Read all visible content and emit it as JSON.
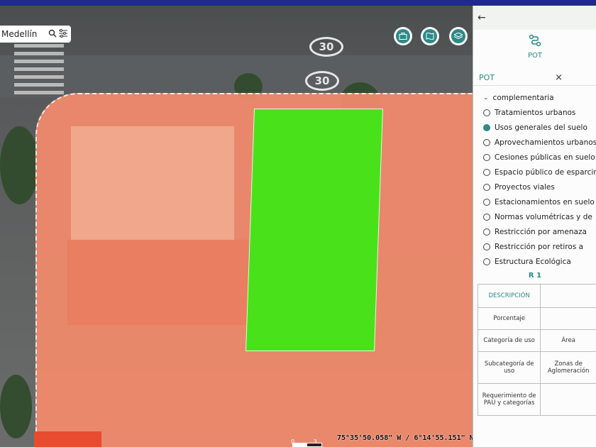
{
  "search": {
    "text": "Medellín"
  },
  "map": {
    "road_labels": [
      "30",
      "30"
    ],
    "scale_labels": [
      "0",
      "3"
    ],
    "coordinates": "75°35'50.058\" W / 6°14'55.151\" N",
    "zone_colors": {
      "red": "#f08a6c",
      "green": "#49e11a"
    }
  },
  "toolbar": {
    "icons": [
      "briefcase-icon",
      "map-icon",
      "layers-icon"
    ]
  },
  "panel": {
    "back": "←",
    "tool_label": "POT",
    "tab_label": "POT",
    "tab_close": "×",
    "section_header": "complementaria",
    "layers": [
      {
        "label": "Tratamientos urbanos",
        "selected": false
      },
      {
        "label": "Usos generales del suelo",
        "selected": true
      },
      {
        "label": "Aprovechamientos urbanos",
        "selected": false
      },
      {
        "label": "Cesiones públicas en suelo",
        "selected": false
      },
      {
        "label": "Espacio público de esparcimiento",
        "selected": false
      },
      {
        "label": "Proyectos viales",
        "selected": false
      },
      {
        "label": "Estacionamientos en suelo",
        "selected": false
      },
      {
        "label": "Normas volumétricas y de",
        "selected": false
      },
      {
        "label": "Restricción por amenaza",
        "selected": false
      },
      {
        "label": "Restricción por retiros a",
        "selected": false
      },
      {
        "label": "Estructura Ecológica",
        "selected": false
      }
    ],
    "result_title": "R 1",
    "table": {
      "header": "DESCRIPCIÓN",
      "rows": [
        {
          "label": "Porcentaje",
          "value": ""
        },
        {
          "label": "Categoría de uso",
          "value": "Área"
        },
        {
          "label": "Subcategoría de uso",
          "value": "Zonas de Aglomeración"
        },
        {
          "label": "Requerimiento de PAU y categorías",
          "value": ""
        }
      ]
    }
  }
}
